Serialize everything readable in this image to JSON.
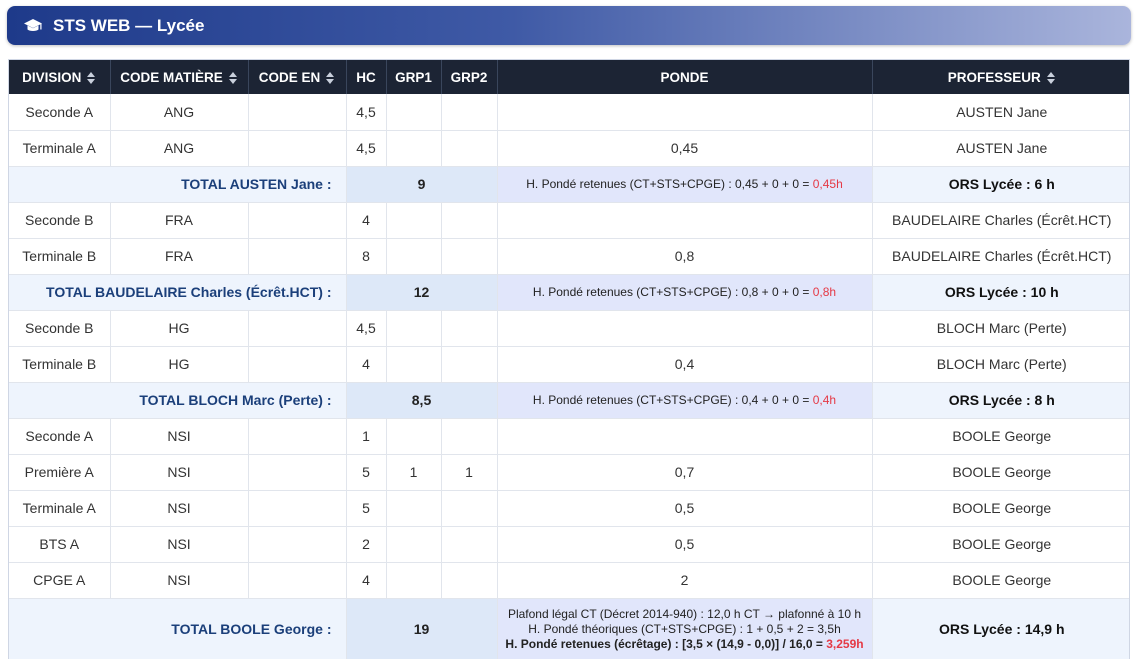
{
  "app": {
    "title": "STS WEB — Lycée"
  },
  "table": {
    "headers": {
      "division": "DIVISION",
      "code_matiere": "CODE MATIÈRE",
      "code_en": "CODE EN",
      "hc": "HC",
      "grp1": "GRP1",
      "grp2": "GRP2",
      "ponde": "PONDE",
      "professeur": "PROFESSEUR"
    },
    "groups": [
      {
        "rows": [
          {
            "division": "Seconde A",
            "matiere": "ANG",
            "code_en": "",
            "hc": "4,5",
            "grp1": "",
            "grp2": "",
            "ponde": "",
            "prof": "AUSTEN Jane"
          },
          {
            "division": "Terminale A",
            "matiere": "ANG",
            "code_en": "",
            "hc": "4,5",
            "grp1": "",
            "grp2": "",
            "ponde": "0,45",
            "prof": "AUSTEN Jane"
          }
        ],
        "total": {
          "label": "TOTAL AUSTEN Jane :",
          "hc": "9",
          "lines": [],
          "retenues_prefix": "H. Pondé retenues (CT+STS+CPGE) : 0,45 + 0 + 0 = ",
          "retenues_value": "0,45h",
          "ors": "ORS Lycée : 6 h"
        }
      },
      {
        "rows": [
          {
            "division": "Seconde B",
            "matiere": "FRA",
            "code_en": "",
            "hc": "4",
            "grp1": "",
            "grp2": "",
            "ponde": "",
            "prof": "BAUDELAIRE Charles (Écrêt.HCT)"
          },
          {
            "division": "Terminale B",
            "matiere": "FRA",
            "code_en": "",
            "hc": "8",
            "grp1": "",
            "grp2": "",
            "ponde": "0,8",
            "prof": "BAUDELAIRE Charles (Écrêt.HCT)"
          }
        ],
        "total": {
          "label": "TOTAL BAUDELAIRE Charles (Écrêt.HCT) :",
          "hc": "12",
          "lines": [],
          "retenues_prefix": "H. Pondé retenues (CT+STS+CPGE) : 0,8 + 0 + 0 = ",
          "retenues_value": "0,8h",
          "ors": "ORS Lycée : 10 h"
        }
      },
      {
        "rows": [
          {
            "division": "Seconde B",
            "matiere": "HG",
            "code_en": "",
            "hc": "4,5",
            "grp1": "",
            "grp2": "",
            "ponde": "",
            "prof": "BLOCH Marc (Perte)"
          },
          {
            "division": "Terminale B",
            "matiere": "HG",
            "code_en": "",
            "hc": "4",
            "grp1": "",
            "grp2": "",
            "ponde": "0,4",
            "prof": "BLOCH Marc (Perte)"
          }
        ],
        "total": {
          "label": "TOTAL BLOCH Marc (Perte) :",
          "hc": "8,5",
          "lines": [],
          "retenues_prefix": "H. Pondé retenues (CT+STS+CPGE) : 0,4 + 0 + 0 = ",
          "retenues_value": "0,4h",
          "ors": "ORS Lycée : 8 h"
        }
      },
      {
        "rows": [
          {
            "division": "Seconde A",
            "matiere": "NSI",
            "code_en": "",
            "hc": "1",
            "grp1": "",
            "grp2": "",
            "ponde": "",
            "prof": "BOOLE George"
          },
          {
            "division": "Première A",
            "matiere": "NSI",
            "code_en": "",
            "hc": "5",
            "grp1": "1",
            "grp2": "1",
            "ponde": "0,7",
            "prof": "BOOLE George"
          },
          {
            "division": "Terminale A",
            "matiere": "NSI",
            "code_en": "",
            "hc": "5",
            "grp1": "",
            "grp2": "",
            "ponde": "0,5",
            "prof": "BOOLE George"
          },
          {
            "division": "BTS A",
            "matiere": "NSI",
            "code_en": "",
            "hc": "2",
            "grp1": "",
            "grp2": "",
            "ponde": "0,5",
            "prof": "BOOLE George"
          },
          {
            "division": "CPGE A",
            "matiere": "NSI",
            "code_en": "",
            "hc": "4",
            "grp1": "",
            "grp2": "",
            "ponde": "2",
            "prof": "BOOLE George"
          }
        ],
        "total": {
          "label": "TOTAL BOOLE George :",
          "hc": "19",
          "lines": [
            "Plafond légal CT (Décret 2014-940) : 12,0 h CT → plafonné à 10 h",
            "H. Pondé théoriques (CT+STS+CPGE) : 1 + 0,5 + 2 = 3,5h"
          ],
          "retenues_prefix": "H. Pondé retenues (écrêtage) : [3,5 × (14,9 - 0,0)] / 16,0 = ",
          "retenues_value": "3,259h",
          "retenues_bold": true,
          "ors": "ORS Lycée : 14,9 h"
        }
      }
    ]
  }
}
